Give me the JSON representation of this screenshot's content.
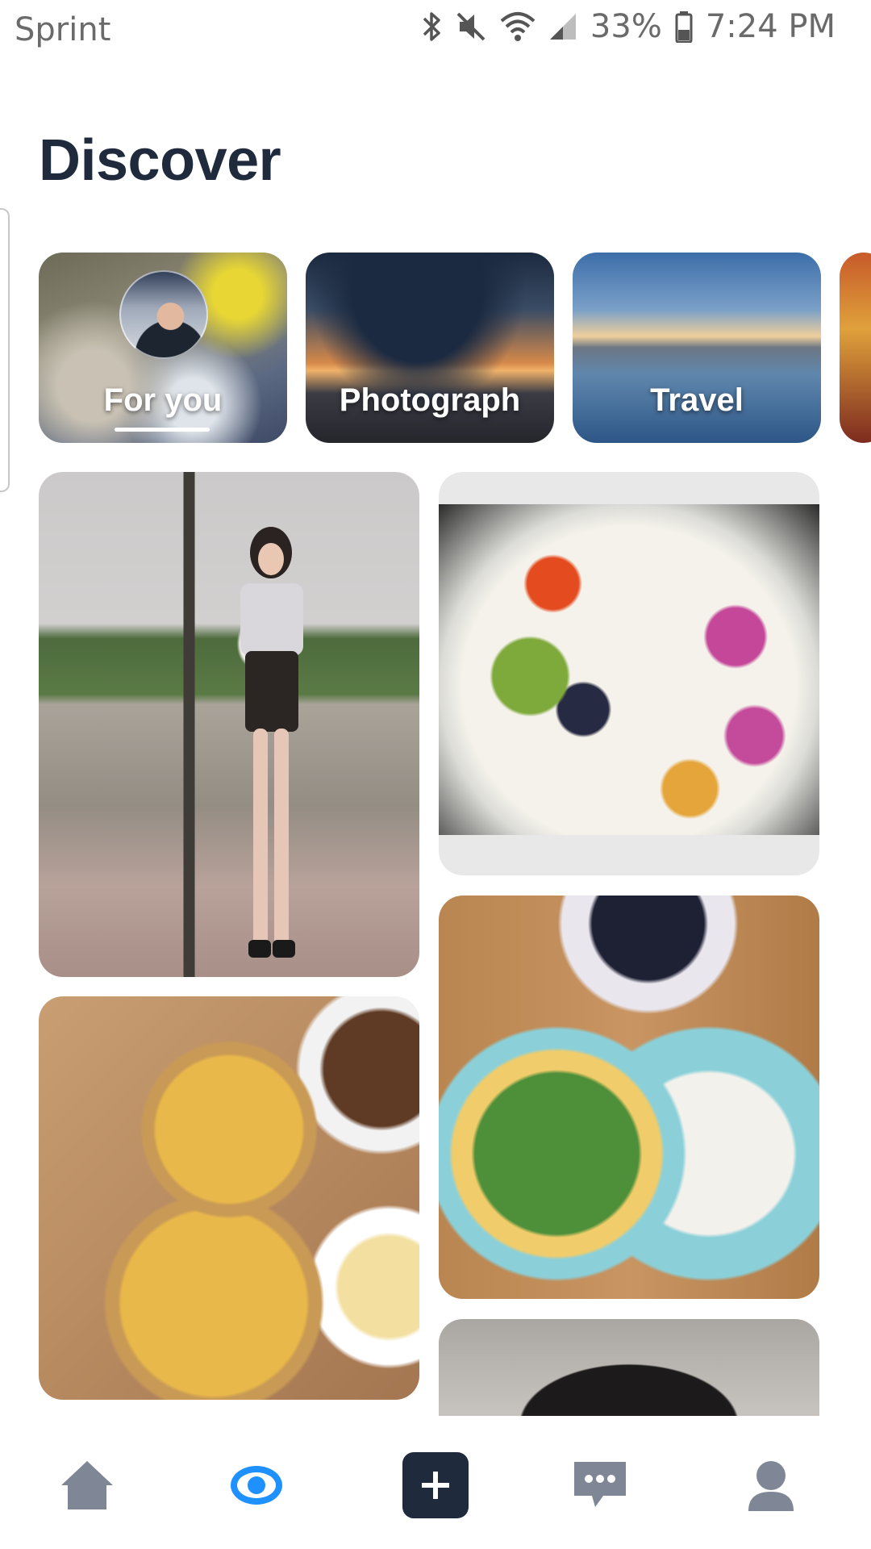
{
  "status_bar": {
    "carrier": "Sprint",
    "battery": "33%",
    "time": "7:24 PM",
    "icons": [
      "bluetooth-icon",
      "mute-icon",
      "wifi-icon",
      "signal-icon",
      "battery-icon"
    ]
  },
  "page": {
    "title": "Discover"
  },
  "categories": [
    {
      "label": "For you",
      "selected": true
    },
    {
      "label": "Photograph",
      "selected": false
    },
    {
      "label": "Travel",
      "selected": false
    }
  ],
  "feed": {
    "items": [
      "girl-photo",
      "fruit-yogurt-photo",
      "bento-photo",
      "pizza-photo",
      "portrait-photo"
    ]
  },
  "bottom_nav": {
    "items": [
      "home-icon",
      "discover-eye-icon",
      "add-icon",
      "messages-icon",
      "profile-icon"
    ],
    "active": "discover-eye-icon"
  },
  "colors": {
    "accent": "#1e90ff",
    "navy": "#1f2a3d",
    "inactive_icon": "#7f8796"
  }
}
